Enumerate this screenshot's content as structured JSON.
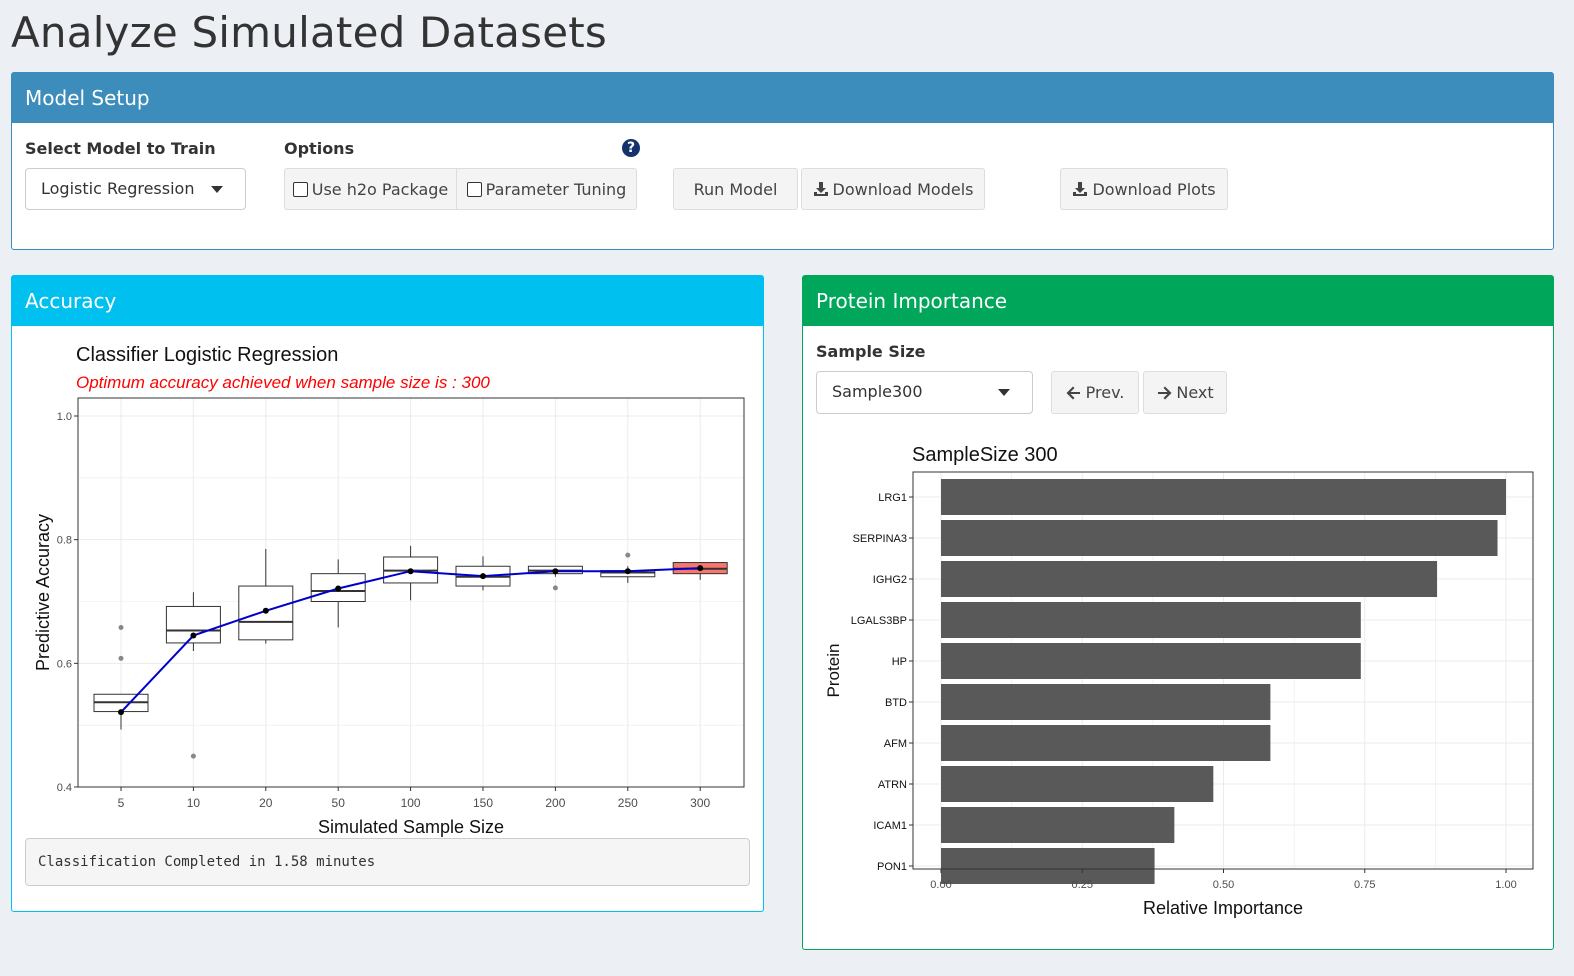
{
  "page": {
    "title": "Analyze Simulated Datasets"
  },
  "model_setup": {
    "title": "Model Setup",
    "select_label": "Select Model to Train",
    "select_value": "Logistic Regression",
    "options_label": "Options",
    "help_icon": "question-circle-icon",
    "checkbox_h2o": "Use h2o Package",
    "checkbox_tuning": "Parameter Tuning",
    "run_button": "Run Model",
    "download_models_button": "Download Models",
    "download_plots_button": "Download Plots",
    "download_icon": "download-icon"
  },
  "accuracy": {
    "title": "Accuracy",
    "status": "Classification Completed in 1.58 minutes"
  },
  "importance": {
    "title": "Protein Importance",
    "sample_label": "Sample Size",
    "sample_value": "Sample300",
    "prev_button": "Prev.",
    "next_button": "Next"
  },
  "colors": {
    "header_blue": "#3c8dbc",
    "header_aqua": "#00c0ef",
    "header_green": "#00a65a",
    "trend_line": "#0000cc",
    "highlight_box": "#f8766d",
    "subtitle_red": "#ff0000",
    "bar_fill": "#595959"
  },
  "chart_data": [
    {
      "type": "box",
      "title": "Classifier Logistic Regression",
      "subtitle": "Optimum accuracy achieved when sample size is : 300",
      "xlabel": "Simulated Sample Size",
      "ylabel": "Predictive Accuracy",
      "categories": [
        "5",
        "10",
        "20",
        "50",
        "100",
        "150",
        "200",
        "250",
        "300"
      ],
      "ylim": [
        0.4,
        1.0
      ],
      "yticks": [
        "0.4",
        "0.6",
        "0.8",
        "1.0"
      ],
      "grid": true,
      "boxes": [
        {
          "q1": 0.522,
          "median": 0.537,
          "q3": 0.55,
          "min": 0.493,
          "max": 0.55,
          "outliers": [
            0.608,
            0.658
          ]
        },
        {
          "q1": 0.633,
          "median": 0.653,
          "q3": 0.692,
          "min": 0.62,
          "max": 0.715,
          "outliers": [
            0.45
          ]
        },
        {
          "q1": 0.638,
          "median": 0.667,
          "q3": 0.725,
          "min": 0.632,
          "max": 0.785,
          "outliers": []
        },
        {
          "q1": 0.7,
          "median": 0.717,
          "q3": 0.745,
          "min": 0.658,
          "max": 0.768,
          "outliers": []
        },
        {
          "q1": 0.73,
          "median": 0.75,
          "q3": 0.772,
          "min": 0.702,
          "max": 0.79,
          "outliers": []
        },
        {
          "q1": 0.725,
          "median": 0.74,
          "q3": 0.757,
          "min": 0.718,
          "max": 0.773,
          "outliers": []
        },
        {
          "q1": 0.745,
          "median": 0.75,
          "q3": 0.757,
          "min": 0.74,
          "max": 0.757,
          "outliers": [
            0.722
          ]
        },
        {
          "q1": 0.74,
          "median": 0.747,
          "q3": 0.75,
          "min": 0.73,
          "max": 0.757,
          "outliers": [
            0.775
          ]
        },
        {
          "q1": 0.745,
          "median": 0.753,
          "q3": 0.763,
          "min": 0.735,
          "max": 0.763,
          "outliers": [],
          "highlight": true
        }
      ],
      "mean_line": [
        0.521,
        0.645,
        0.685,
        0.721,
        0.749,
        0.741,
        0.749,
        0.749,
        0.754
      ]
    },
    {
      "type": "bar",
      "orientation": "horizontal",
      "title": "SampleSize 300",
      "xlabel": "Relative Importance",
      "ylabel": "Protein",
      "categories": [
        "LRG1",
        "SERPINA3",
        "IGHG2",
        "LGALS3BP",
        "HP",
        "BTD",
        "AFM",
        "ATRN",
        "ICAM1",
        "PON1"
      ],
      "values": [
        1.0,
        0.985,
        0.878,
        0.743,
        0.743,
        0.583,
        0.583,
        0.482,
        0.413,
        0.378
      ],
      "xlim": [
        0.0,
        1.0
      ],
      "xticks": [
        "0.00",
        "0.25",
        "0.50",
        "0.75",
        "1.00"
      ],
      "grid": true
    }
  ]
}
